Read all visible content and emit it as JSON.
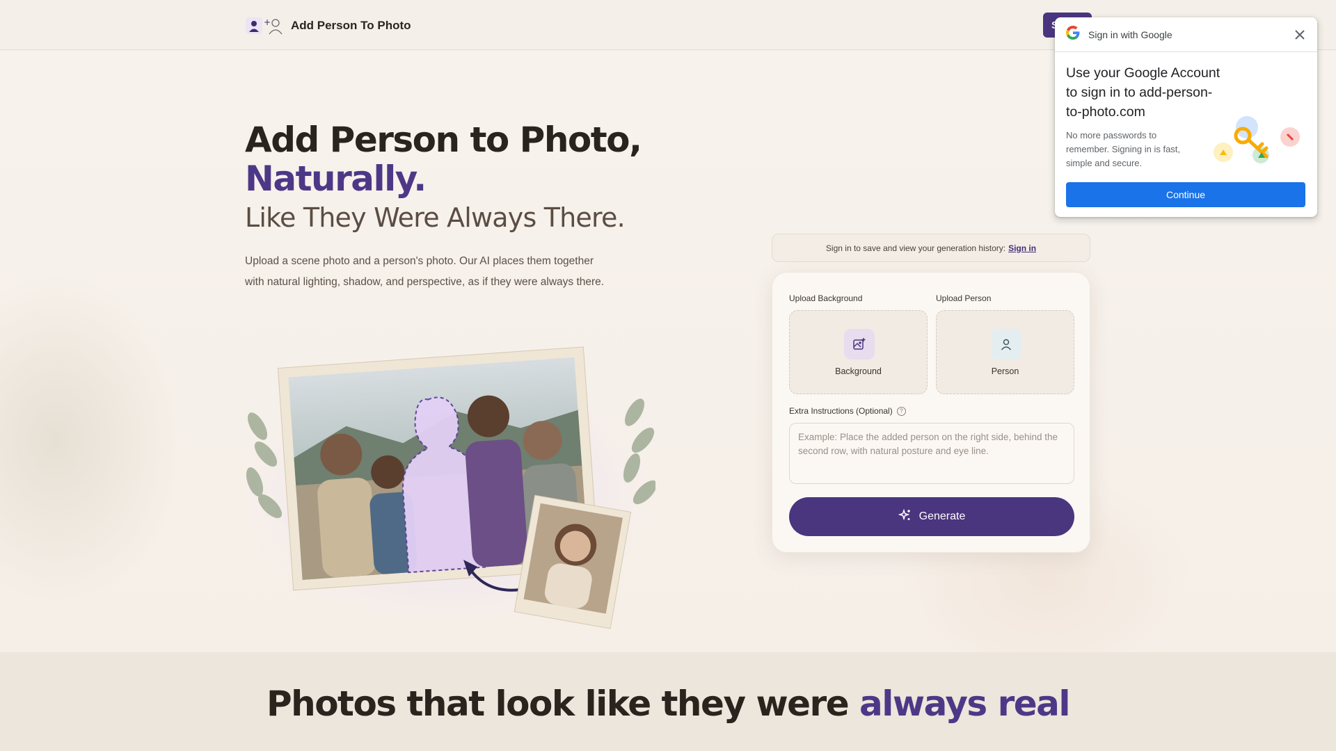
{
  "header": {
    "brand_title": "Add Person To Photo",
    "signin_label": "Sign in"
  },
  "hero": {
    "title_line1": "Add Person to Photo,",
    "title_line2": "Naturally.",
    "subtitle": "Like They Were Always There.",
    "description": "Upload a scene photo and a person's photo. Our AI places them together with natural lighting, shadow, and perspective, as if they were always there."
  },
  "history": {
    "text": "Sign in to save and view your generation history:",
    "link": "Sign in"
  },
  "upload": {
    "background_label": "Upload Background",
    "background_text": "Background",
    "person_label": "Upload Person",
    "person_text": "Person",
    "extra_label": "Extra Instructions (Optional)",
    "extra_placeholder": "Example: Place the added person on the right side, behind the second row, with natural posture and eye line.",
    "generate_label": "Generate"
  },
  "google_one_tap": {
    "header": "Sign in with Google",
    "title": "Use your Google Account to sign in to add-person-to-photo.com",
    "body": "No more passwords to remember. Signing in is fast, simple and secure.",
    "continue_label": "Continue"
  },
  "section2": {
    "title_part1": "Photos that look like they were",
    "title_accent": "always real"
  },
  "colors": {
    "brand_purple": "#4a357f",
    "google_blue": "#1a73e8",
    "page_bg": "#f6f1ea"
  }
}
